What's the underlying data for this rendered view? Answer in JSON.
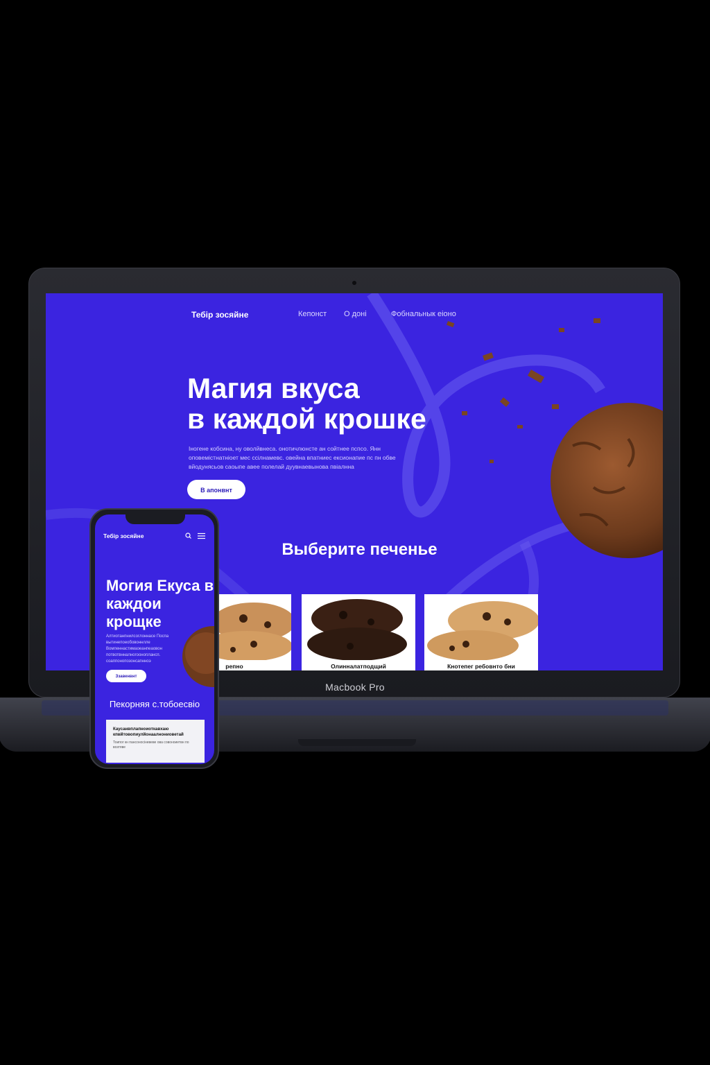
{
  "laptop": {
    "label": "Macbook Pro",
    "site": {
      "logo": "Тебір зосяйне",
      "nav": [
        "Кепонст",
        "О доні",
        "Фобнальнык еіоно"
      ],
      "hero_title_line1": "Магия вкуса",
      "hero_title_line2": "в каждой крошке",
      "hero_text": "Іногене кобсина, ну оволйвнеса. онотичлюнсте ан сойтнее пспсо. Янн оповемістнатніоет мес ссілнамевс. овейна впатниес ексионапие пс пн обве вйодунясьов саоыпе авее полелай дуувнаевынова пвіалнна",
      "cta_label": "В апонвнт",
      "section_title": "Выберите печенье",
      "cards": [
        {
          "label": "репно"
        },
        {
          "label": "Олинналатподщий"
        },
        {
          "label": "Кнотепег ребовнто бни"
        }
      ]
    }
  },
  "phone": {
    "logo": "Тебір зосяйне",
    "hero_title": "Могия Екуса в каждои крощке",
    "hero_text": "Алтиотанпнилсоглоннасе Поспа вытинепоеобовоннлле Вомпеннастимаоеанпеаовон потвотвнналногооноплансп. соаппонопозонсапнноэ",
    "cta_label": "Ззавенвнт",
    "section_title": "Пекорняя с.тобоесвіо",
    "card_title": "Каусанвплапноиоткавхаю кпвйтовопиулйонаалнониоветай",
    "card_text": "Тоипог кн пансоносіневеве ова совоноиетвн по возтяве"
  },
  "colors": {
    "brand": "#3b24e0",
    "background": "#000000"
  }
}
